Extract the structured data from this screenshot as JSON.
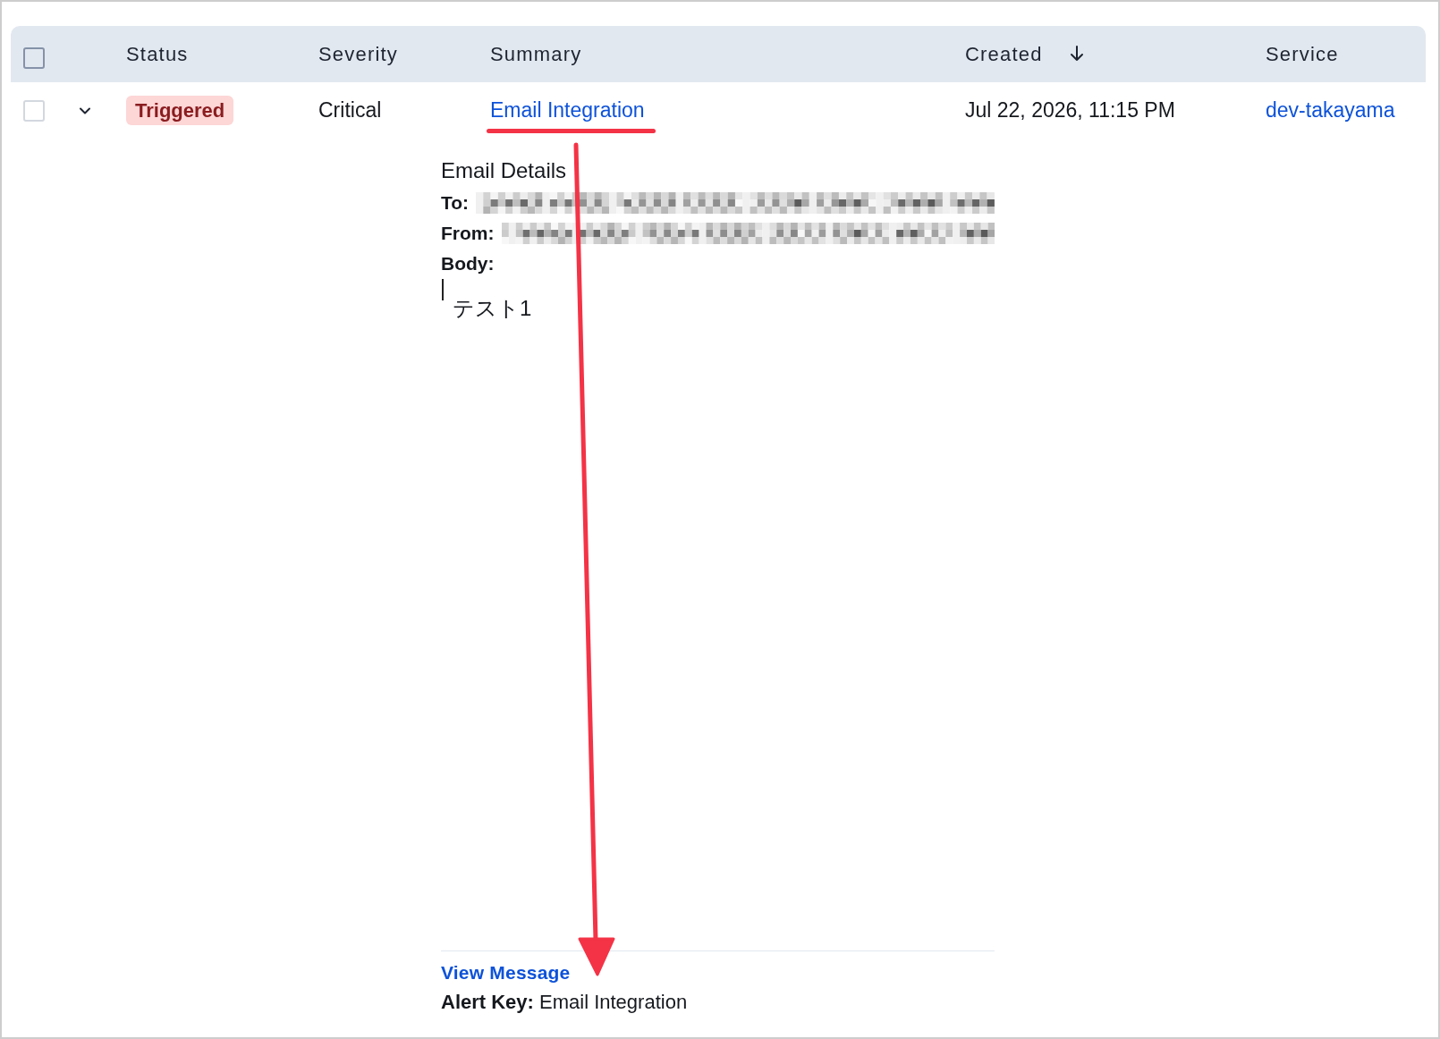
{
  "table": {
    "select_all": {
      "checked": false
    },
    "columns": [
      {
        "label": "Status",
        "sorted": false
      },
      {
        "label": "Severity",
        "sorted": false
      },
      {
        "label": "Summary",
        "sorted": false
      },
      {
        "label": "Created",
        "sorted": true
      },
      {
        "label": "Service",
        "sorted": false
      }
    ],
    "rows": [
      {
        "checked": false,
        "expanded": true,
        "status": {
          "label": "Triggered",
          "kind": "triggered"
        },
        "severity": "Critical",
        "summary": "Email Integration",
        "created": "Jul 22, 2026, 11:15 PM",
        "service": "dev-takayama",
        "details": {
          "title": "Email Details",
          "fields": [
            {
              "label": "To:",
              "kind": "redacted"
            },
            {
              "label": "From:",
              "kind": "redacted"
            }
          ],
          "body": {
            "label": "Body:",
            "text": "テスト1"
          },
          "link": "View Message",
          "alert_key": "**Alert Key:** Email Integration"
        }
      }
    ]
  },
  "annotations": {
    "underline": true,
    "arrow": true
  }
}
